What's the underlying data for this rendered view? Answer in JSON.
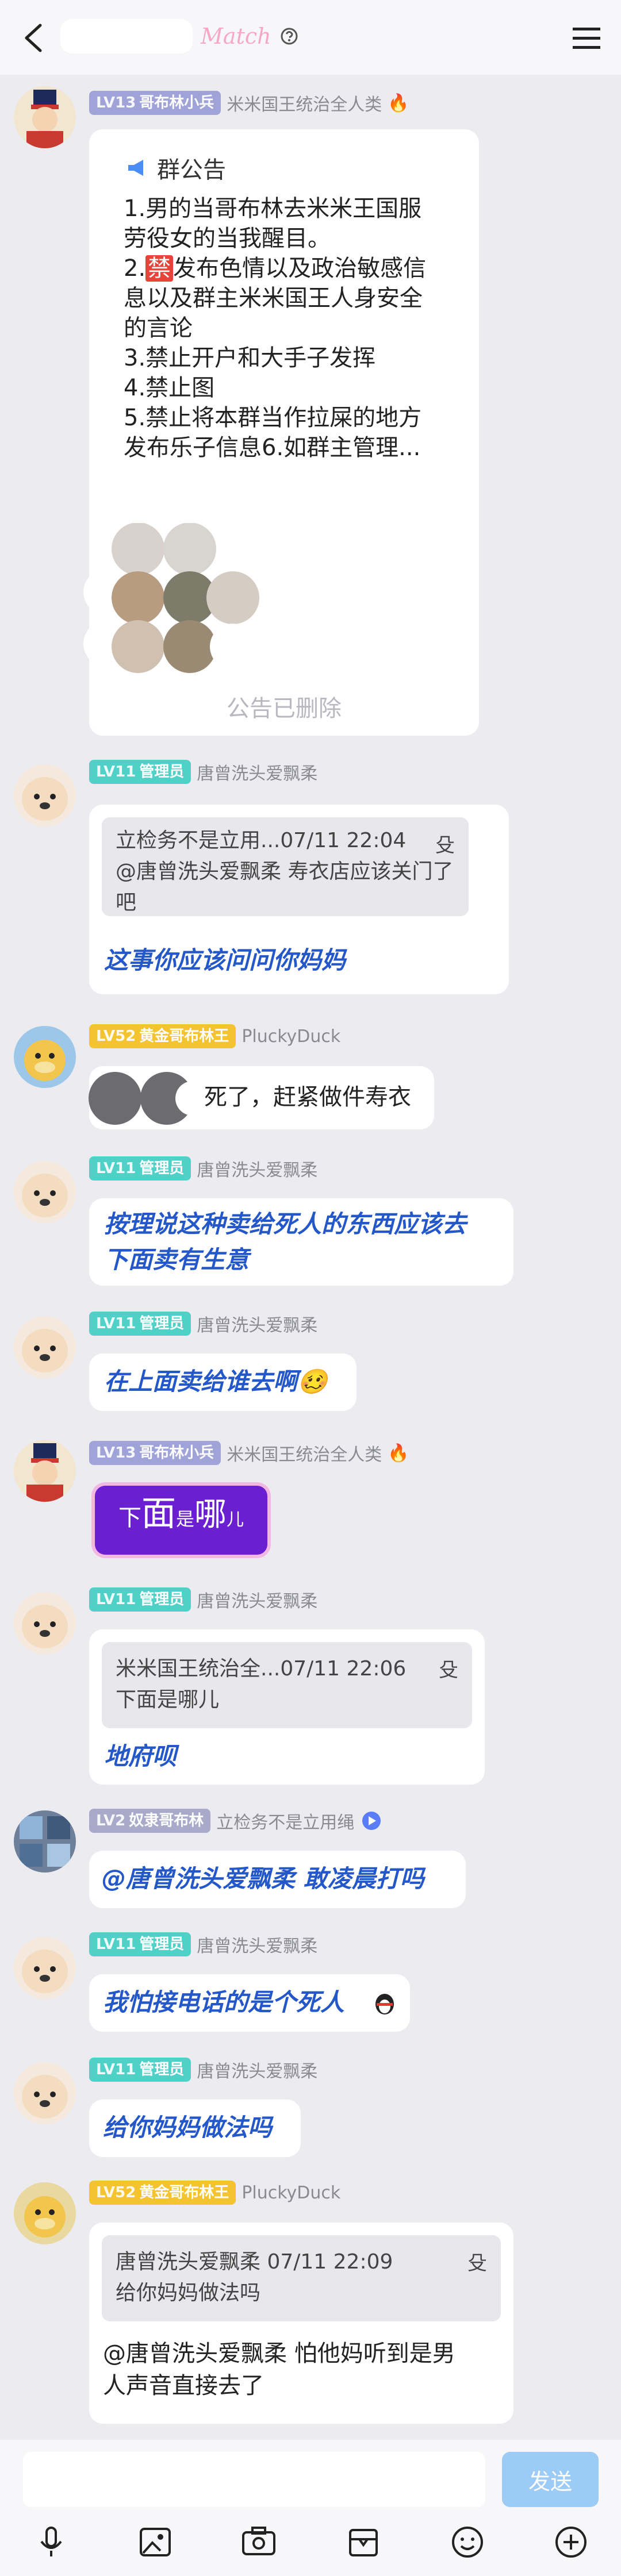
{
  "header": {
    "title_mark": "Match"
  },
  "announcement": {
    "heading": "群公告",
    "lines": [
      "1.男的当哥布林去米米王国服",
      "劳役女的当我醒目。",
      "2.",
      "禁",
      "发布色情以及政治敏感信",
      "息以及群主米米国王人身安全",
      "的言论",
      "3.禁止开户和大手子发挥",
      "4.禁止图",
      "5.禁止将本群当作拉屎的地方",
      "发布乐子信息6.如群主管理..."
    ],
    "footer": "公告已删除"
  },
  "messages": [
    {
      "level": "LV13",
      "badge": "哥布林小兵",
      "name": "米米国王统治全人类",
      "flag": "🔥"
    },
    {
      "level": "LV11",
      "badge": "管理员",
      "name": "唐曾洗头爱飘柔",
      "quote_head": "立检务不是立用...07/11 22:04",
      "quote_body": "@唐曾洗头爱飘柔 寿衣店应该关门了吧",
      "quote_lines": [
        "@唐曾洗头爱飘柔 寿衣店应该关门了",
        "吧"
      ],
      "text": "这事你应该问问你妈妈"
    },
    {
      "level": "LV52",
      "badge": "黄金哥布林王",
      "name": "PluckyDuck",
      "text": "死了，赶紧做件寿衣"
    },
    {
      "level": "LV11",
      "badge": "管理员",
      "name": "唐曾洗头爱飘柔",
      "lines": [
        "按理说这种卖给死人的东西应该去",
        "下面卖有生意"
      ]
    },
    {
      "level": "LV11",
      "badge": "管理员",
      "name": "唐曾洗头爱飘柔",
      "text": "在上面卖给谁去啊🥴"
    },
    {
      "level": "LV13",
      "badge": "哥布林小兵",
      "name": "米米国王统治全人类",
      "flag": "🔥",
      "sticker": [
        "下",
        "面",
        "是",
        "哪",
        "儿"
      ]
    },
    {
      "level": "LV11",
      "badge": "管理员",
      "name": "唐曾洗头爱飘柔",
      "quote_head": "米米国王统治全...07/11 22:06",
      "quote_body": "下面是哪儿",
      "text": "地府呗"
    },
    {
      "level": "LV2",
      "badge": "奴隶哥布林",
      "name": "立检务不是立用绳",
      "text": "@唐曾洗头爱飘柔 敢凌晨打吗"
    },
    {
      "level": "LV11",
      "badge": "管理员",
      "name": "唐曾洗头爱飘柔",
      "text": "我怕接电话的是个死人"
    },
    {
      "level": "LV11",
      "badge": "管理员",
      "name": "唐曾洗头爱飘柔",
      "text": "给你妈妈做法吗"
    },
    {
      "level": "LV52",
      "badge": "黄金哥布林王",
      "name": "PluckyDuck",
      "quote_head": "唐曾洗头爱飘柔 07/11 22:09",
      "quote_body": "给你妈妈做法吗",
      "lines": [
        "@唐曾洗头爱飘柔 怕他妈听到是男",
        "人声音直接去了"
      ]
    }
  ],
  "pin_glyph": "⽎",
  "input": {
    "send_label": "发送"
  },
  "toolbar": [
    "mic-icon",
    "image-icon",
    "camera-icon",
    "gift-icon",
    "emoji-icon",
    "plus-icon"
  ]
}
